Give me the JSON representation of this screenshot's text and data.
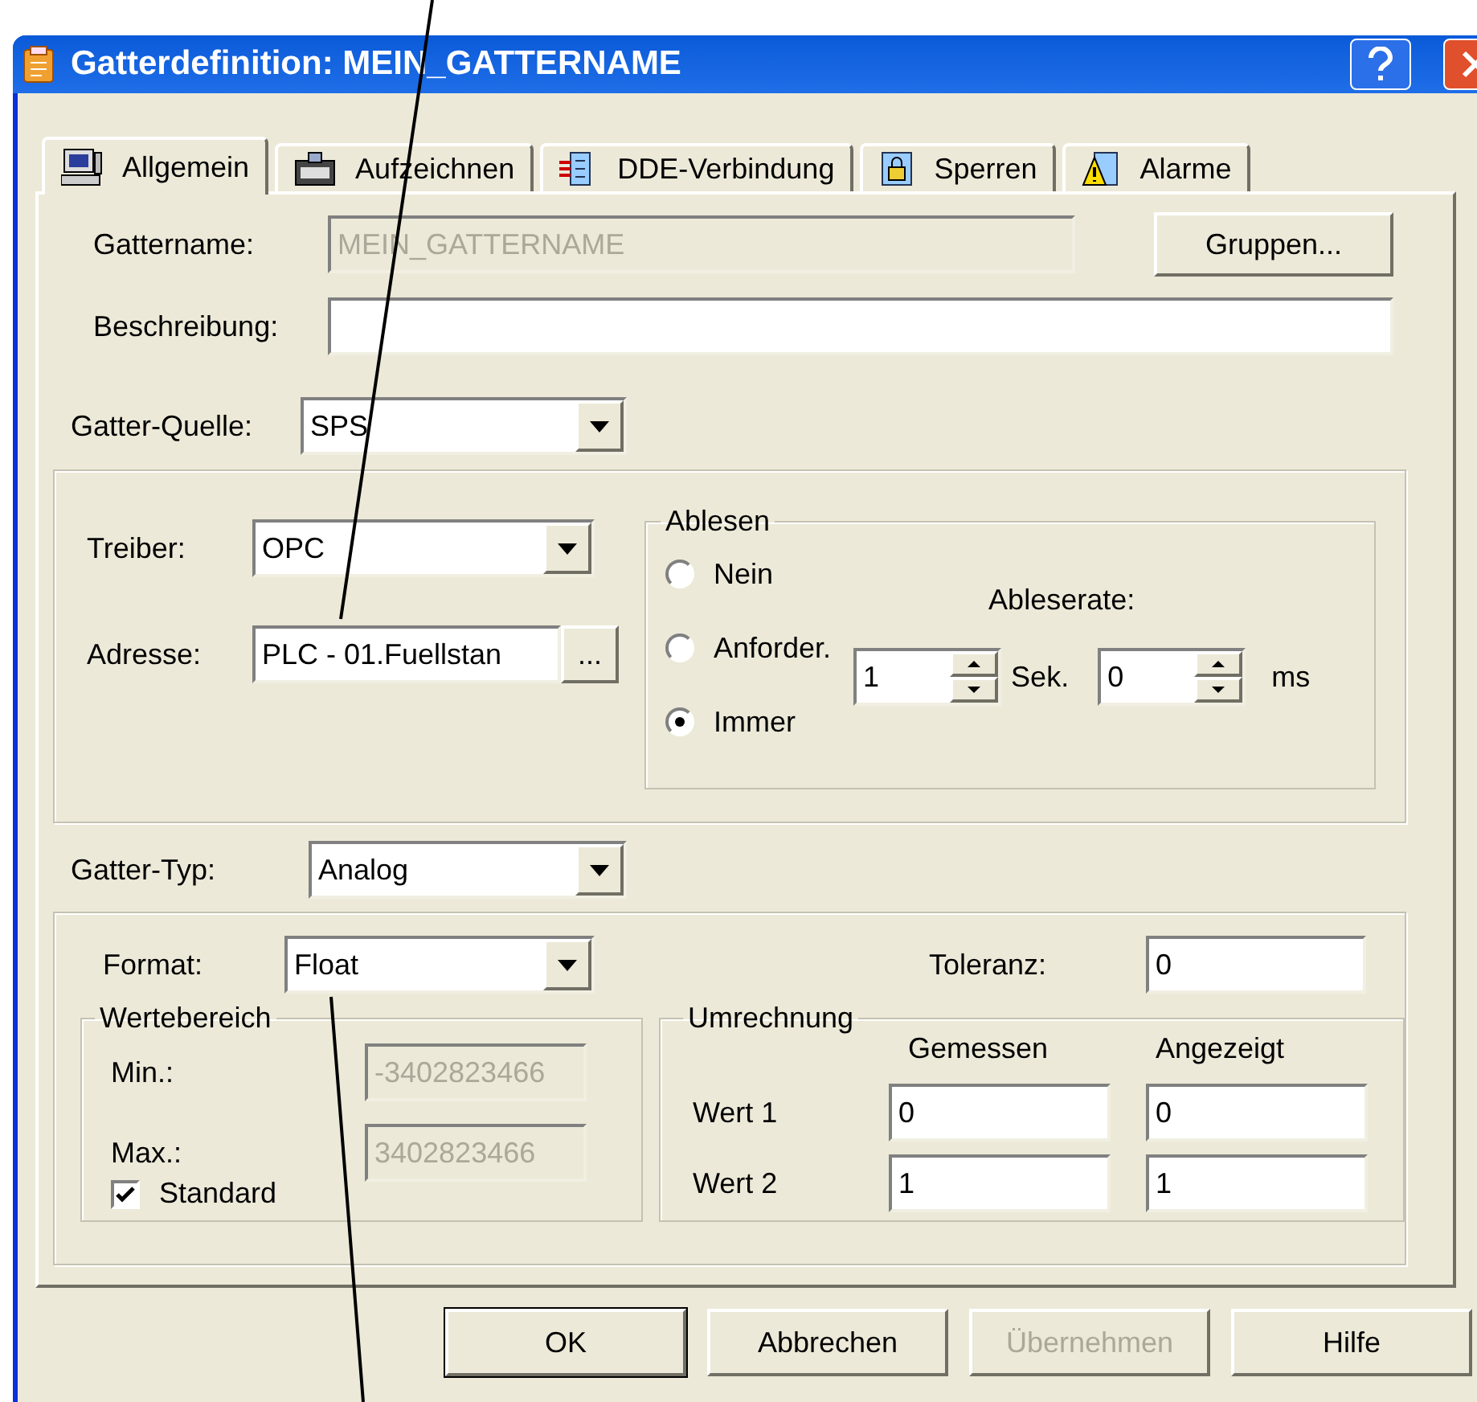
{
  "window": {
    "title": "Gatterdefinition: MEIN_GATTERNAME"
  },
  "tabs": [
    {
      "label": "Allgemein",
      "selected": true
    },
    {
      "label": "Aufzeichnen",
      "selected": false
    },
    {
      "label": "DDE-Verbindung",
      "selected": false
    },
    {
      "label": "Sperren",
      "selected": false
    },
    {
      "label": "Alarme",
      "selected": false
    }
  ],
  "name": {
    "label": "Gattername:",
    "value": "MEIN_GATTERNAME",
    "disabled": true
  },
  "groups_button": "Gruppen...",
  "description": {
    "label": "Beschreibung:"
  },
  "source": {
    "label": "Gatter-Quelle:",
    "value": "SPS"
  },
  "driver": {
    "label": "Treiber:",
    "value": "OPC"
  },
  "address": {
    "label": "Adresse:",
    "value": "PLC - 01.Fuellstan",
    "browse": "..."
  },
  "reading": {
    "title": "Ablesen",
    "options": [
      {
        "label": "Nein",
        "selected": false
      },
      {
        "label": "Anforder.",
        "selected": false
      },
      {
        "label": "Immer",
        "selected": true
      }
    ],
    "rate_label": "Ableserate:",
    "seconds": {
      "value": "1",
      "unit": "Sek."
    },
    "millis": {
      "value": "0",
      "unit": "ms"
    }
  },
  "type": {
    "label": "Gatter-Typ:",
    "value": "Analog"
  },
  "format": {
    "label": "Format:",
    "value": "Float"
  },
  "tolerance": {
    "label": "Toleranz:",
    "value": "0"
  },
  "range": {
    "title": "Wertebereich",
    "min": {
      "label": "Min.:",
      "value": "-3402823466",
      "disabled": true
    },
    "max": {
      "label": "Max.:",
      "value": "3402823466",
      "disabled": true
    },
    "standard": {
      "label": "Standard",
      "checked": true
    }
  },
  "conversion": {
    "title": "Umrechnung",
    "columns": [
      "Gemessen",
      "Angezeigt"
    ],
    "rows": [
      {
        "label": "Wert 1",
        "values": [
          "0",
          "0"
        ]
      },
      {
        "label": "Wert 2",
        "values": [
          "1",
          "1"
        ]
      }
    ]
  },
  "buttons": [
    {
      "label": "OK",
      "default": true,
      "disabled": false
    },
    {
      "label": "Abbrechen",
      "default": false,
      "disabled": false
    },
    {
      "label": "Übernehmen",
      "default": false,
      "disabled": true
    },
    {
      "label": "Hilfe",
      "default": false,
      "disabled": false
    }
  ]
}
